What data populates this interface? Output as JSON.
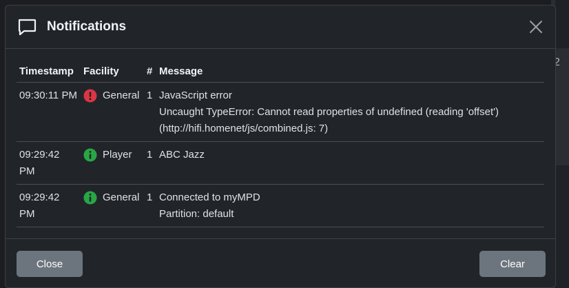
{
  "modal": {
    "title": "Notifications",
    "icon": "chat-square-icon",
    "close_icon": "close-x-icon"
  },
  "table": {
    "headers": [
      "Timestamp",
      "Facility",
      "#",
      "Message"
    ],
    "rows": [
      {
        "timestamp": "09:30:11 PM",
        "severity": "error",
        "facility": "General",
        "count": "1",
        "message": "JavaScript error",
        "details": "Uncaught TypeError: Cannot read properties of undefined (reading 'offset') (http://hifi.homenet/js/combined.js: 7)"
      },
      {
        "timestamp": "09:29:42 PM",
        "severity": "info",
        "facility": "Player",
        "count": "1",
        "message": "ABC Jazz",
        "details": ""
      },
      {
        "timestamp": "09:29:42 PM",
        "severity": "info",
        "facility": "General",
        "count": "1",
        "message": "Connected to myMPD",
        "details": "Partition: default"
      }
    ]
  },
  "footer": {
    "close_label": "Close",
    "clear_label": "Clear"
  },
  "background": {
    "partial_char": "2"
  },
  "colors": {
    "error": "#dc3545",
    "info": "#28a745",
    "button": "#6c757d"
  }
}
